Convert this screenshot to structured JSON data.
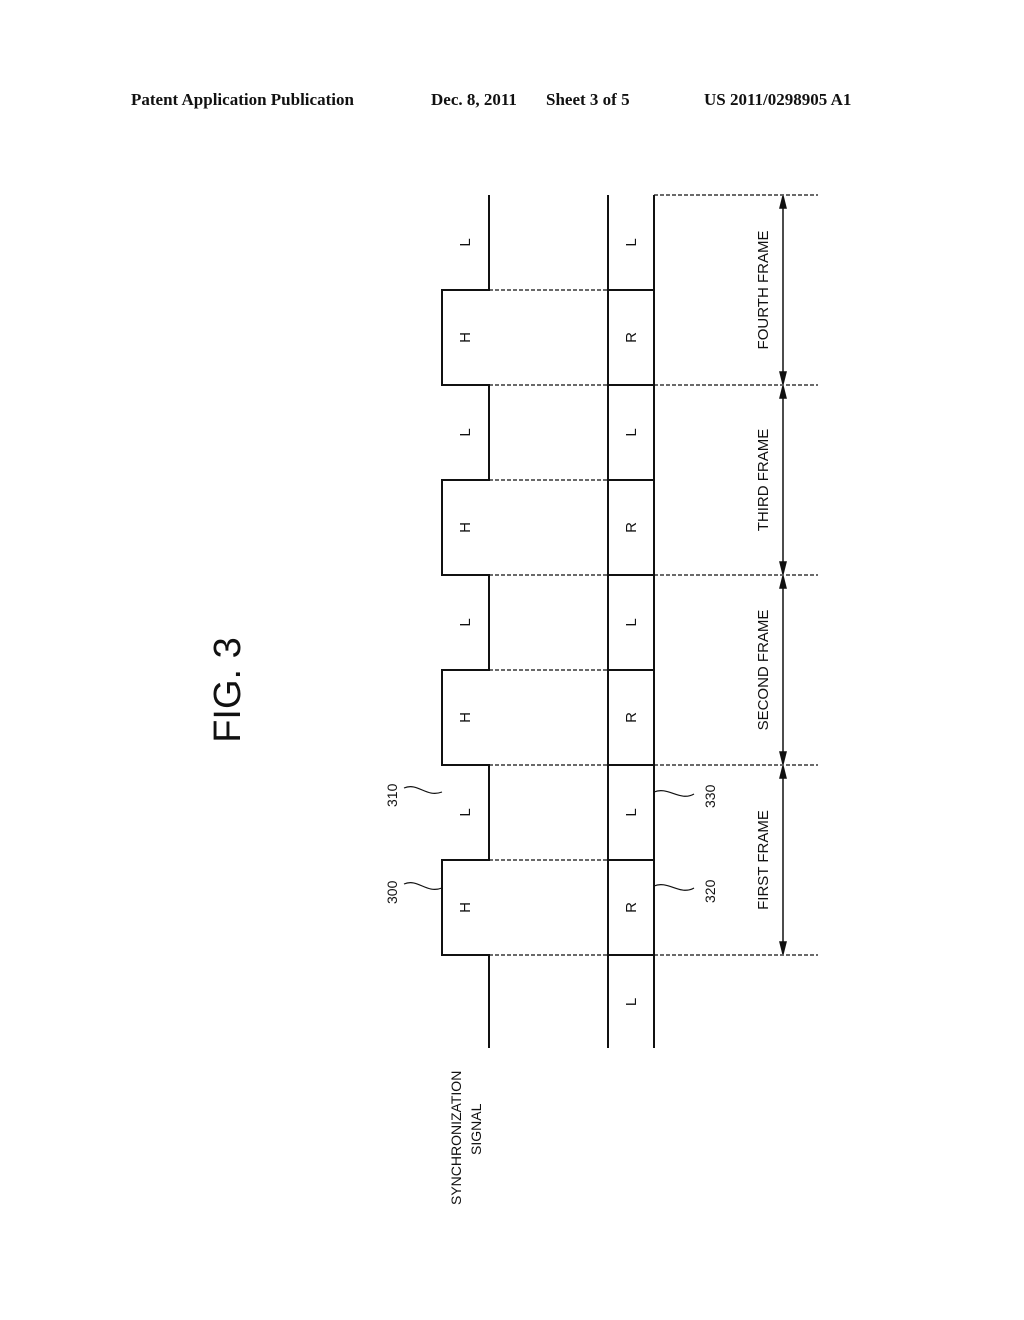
{
  "header": {
    "publication": "Patent Application Publication",
    "date": "Dec. 8, 2011",
    "sheet": "Sheet 3 of 5",
    "number": "US 2011/0298905 A1"
  },
  "figure": {
    "title": "FIG. 3",
    "signal_label_line1": "SYNCHRONIZATION",
    "signal_label_line2": "SIGNAL",
    "initial_state": "L",
    "frames": [
      {
        "name": "FIRST FRAME",
        "sync_high": "H",
        "sync_low": "L",
        "eye_high": "R",
        "eye_low": "L"
      },
      {
        "name": "SECOND FRAME",
        "sync_high": "H",
        "sync_low": "L",
        "eye_high": "R",
        "eye_low": "L"
      },
      {
        "name": "THIRD FRAME",
        "sync_high": "H",
        "sync_low": "L",
        "eye_high": "R",
        "eye_low": "L"
      },
      {
        "name": "FOURTH FRAME",
        "sync_high": "H",
        "sync_low": "L",
        "eye_high": "R",
        "eye_low": "L"
      }
    ],
    "refs": {
      "r300": "300",
      "r310": "310",
      "r320": "320",
      "r330": "330"
    }
  }
}
